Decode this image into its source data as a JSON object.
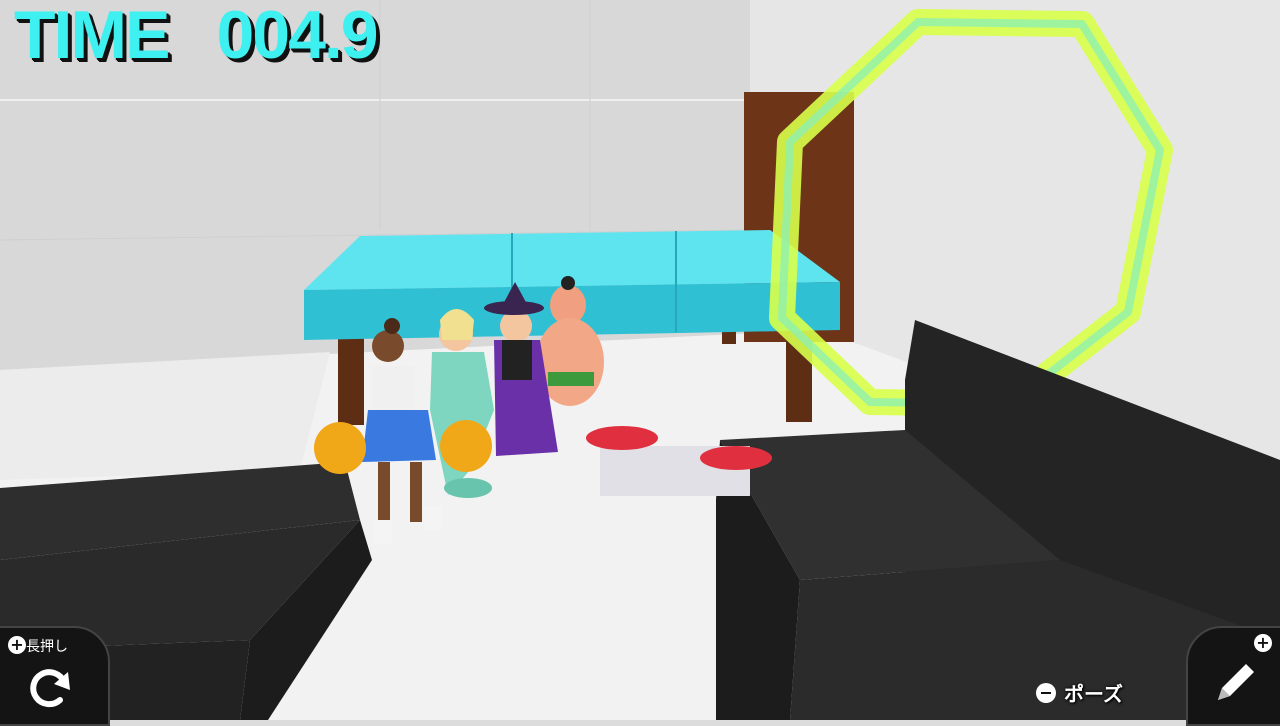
{
  "hud": {
    "time_label": "TIME",
    "time_value": "004.9",
    "time_color": "#3ef0f0"
  },
  "controls": {
    "restart_hint": "長押し",
    "restart_icon": "restart-icon",
    "pause_label": "ポーズ",
    "pause_icon": "minus-button-icon",
    "edit_icon": "pencil-icon"
  },
  "scene": {
    "ring_color": "#d8ff4a",
    "table_color": "#3ec8d8",
    "block_color": "#2a2a2a",
    "characters": [
      "cheerleader",
      "mermaid",
      "witch",
      "sumo-wrestler"
    ]
  }
}
